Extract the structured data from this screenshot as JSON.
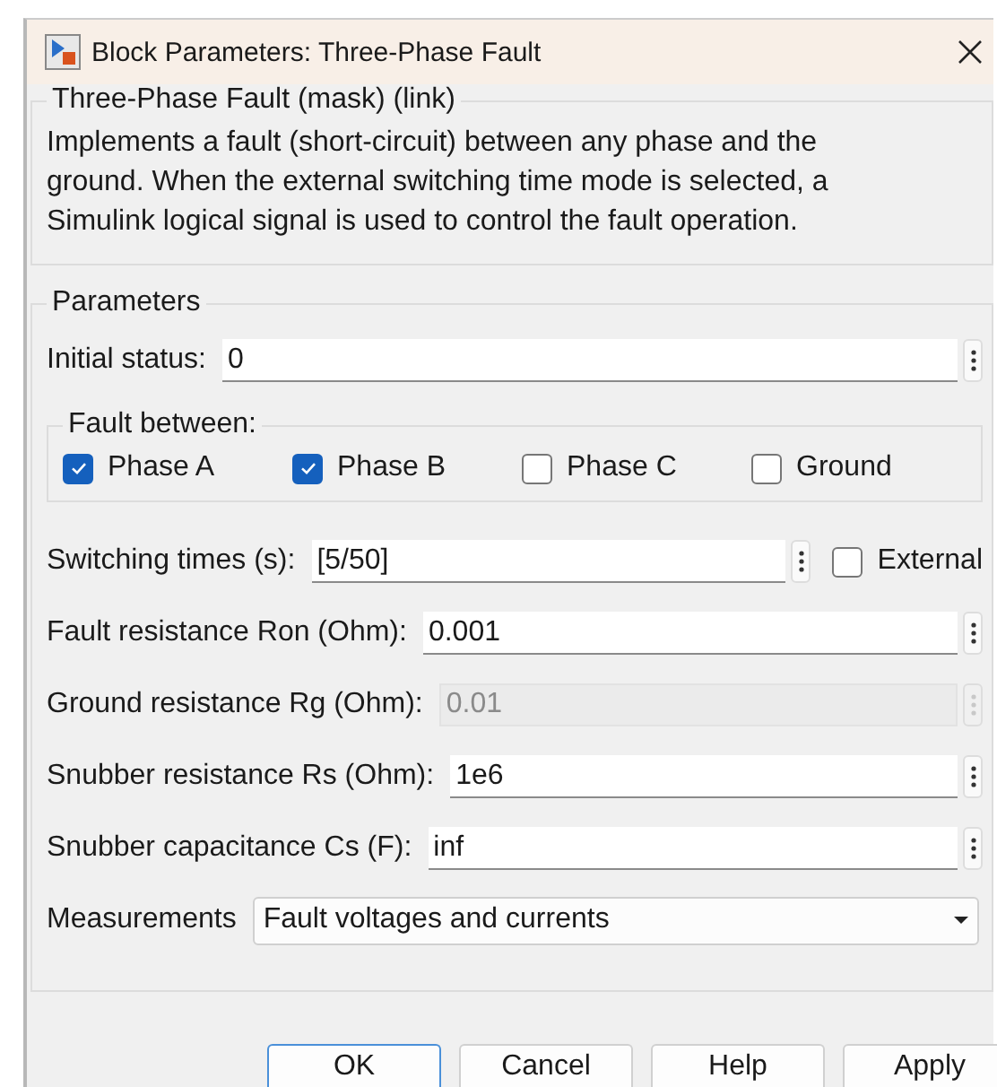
{
  "window": {
    "title": "Block Parameters: Three-Phase Fault"
  },
  "description": {
    "title": "Three-Phase Fault (mask) (link)",
    "text": "Implements a fault (short-circuit) between any phase and the ground. When the external switching time mode is selected, a Simulink logical signal is used to control the fault operation."
  },
  "parameters": {
    "title": "Parameters",
    "rows": [
      {
        "kind": "field",
        "label": "Initial status:",
        "value": "0",
        "disabled": false
      },
      {
        "kind": "checkgroup",
        "title": "Fault between:",
        "options": [
          {
            "label": "Phase A",
            "checked": true
          },
          {
            "label": "Phase B",
            "checked": true
          },
          {
            "label": "Phase C",
            "checked": false
          },
          {
            "label": "Ground",
            "checked": false
          }
        ]
      },
      {
        "kind": "field",
        "label": "Switching times (s):",
        "value": "[5/50]",
        "disabled": false,
        "external": {
          "label": "External",
          "checked": false
        }
      },
      {
        "kind": "field",
        "label": "Fault resistance Ron (Ohm):",
        "value": "0.001",
        "disabled": false
      },
      {
        "kind": "field",
        "label": "Ground resistance Rg (Ohm):",
        "value": "0.01",
        "disabled": true
      },
      {
        "kind": "field",
        "label": "Snubber resistance Rs (Ohm):",
        "value": "1e6",
        "disabled": false
      },
      {
        "kind": "field",
        "label": "Snubber capacitance Cs (F):",
        "value": "inf",
        "disabled": false
      },
      {
        "kind": "dropdown",
        "label": "Measurements",
        "value": "Fault voltages and currents"
      }
    ]
  },
  "buttons": [
    {
      "label": "OK",
      "default": true
    },
    {
      "label": "Cancel",
      "default": false
    },
    {
      "label": "Help",
      "default": false
    },
    {
      "label": "Apply",
      "default": false
    }
  ]
}
